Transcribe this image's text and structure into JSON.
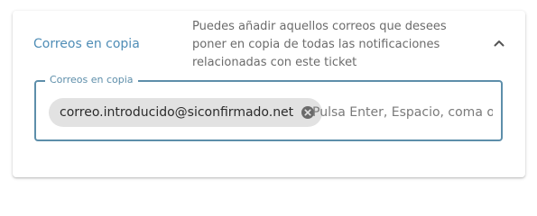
{
  "section": {
    "title": "Correos en copia",
    "description": "Puedes añadir aquellos correos que desees poner en copia de todas las notificaciones relacionadas con este ticket",
    "expand_icon": "chevron-up-icon"
  },
  "field": {
    "legend": "Correos en copia",
    "chips": [
      {
        "label": "correo.introducido@siconfirmado.net",
        "delete_icon": "cancel-circle-icon"
      }
    ],
    "placeholder": "Pulsa Enter, Espacio, coma o Tab para añadir"
  },
  "colors": {
    "accent": "#4f8db6",
    "field_border": "#5d8eaa",
    "chip_bg": "#e2e2e2"
  }
}
